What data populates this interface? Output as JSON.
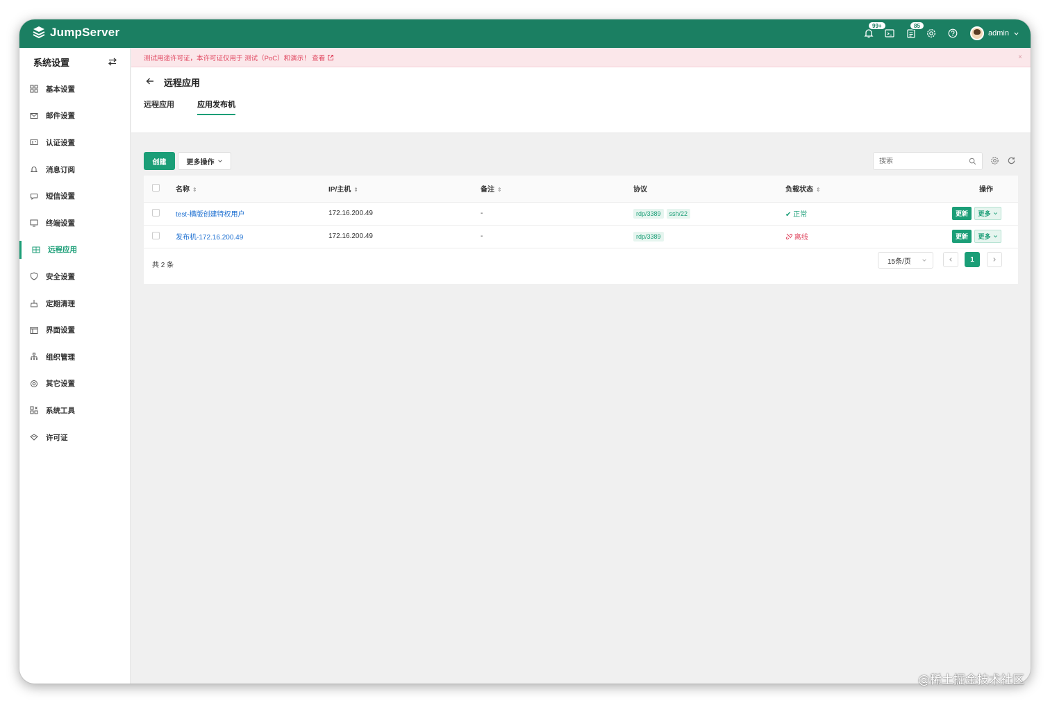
{
  "app": {
    "brand": "JumpServer",
    "accent": "#1b7f62",
    "primary": "#1b9e77"
  },
  "topbar": {
    "notifications_badge": "99+",
    "tickets_badge": "85",
    "user": "admin",
    "icons": [
      "bell-icon",
      "terminal-icon",
      "clipboard-icon",
      "gear-icon",
      "help-icon"
    ]
  },
  "sidebar": {
    "title": "系统设置",
    "items": [
      {
        "label": "基本设置",
        "icon": "grid-icon"
      },
      {
        "label": "邮件设置",
        "icon": "mail-icon"
      },
      {
        "label": "认证设置",
        "icon": "id-card-icon"
      },
      {
        "label": "消息订阅",
        "icon": "bell-icon"
      },
      {
        "label": "短信设置",
        "icon": "chat-icon"
      },
      {
        "label": "终端设置",
        "icon": "monitor-icon"
      },
      {
        "label": "远程应用",
        "icon": "app-icon",
        "active": true
      },
      {
        "label": "安全设置",
        "icon": "shield-icon"
      },
      {
        "label": "定期清理",
        "icon": "broom-icon"
      },
      {
        "label": "界面设置",
        "icon": "window-icon"
      },
      {
        "label": "组织管理",
        "icon": "org-icon"
      },
      {
        "label": "其它设置",
        "icon": "cog-icon"
      },
      {
        "label": "系统工具",
        "icon": "tools-icon"
      },
      {
        "label": "许可证",
        "icon": "license-icon"
      }
    ]
  },
  "alert": {
    "text": "测试用途许可证，本许可证仅用于 测试（PoC）和演示！ 查看",
    "close": "×"
  },
  "page": {
    "title": "远程应用",
    "tabs": [
      {
        "label": "远程应用"
      },
      {
        "label": "应用发布机",
        "active": true
      }
    ]
  },
  "toolbar": {
    "create": "创建",
    "more_actions": "更多操作",
    "search_placeholder": "搜索"
  },
  "table": {
    "headers": {
      "name": "名称",
      "ip": "IP/主机",
      "comment": "备注",
      "protocols": "协议",
      "status": "负载状态",
      "actions": "操作"
    },
    "rows": [
      {
        "name": "test-横版创建特权用户",
        "ip": "172.16.200.49",
        "comment": "-",
        "protocols": [
          "rdp/3389",
          "ssh/22"
        ],
        "status": "正常",
        "status_kind": "ok",
        "update": "更新",
        "more": "更多"
      },
      {
        "name": "发布机-172.16.200.49",
        "ip": "172.16.200.49",
        "comment": "-",
        "protocols": [
          "rdp/3389"
        ],
        "status": "离线",
        "status_kind": "offline",
        "update": "更新",
        "more": "更多"
      }
    ]
  },
  "pagination": {
    "total": "共 2 条",
    "page_size": "15条/页",
    "current_page": "1"
  },
  "watermark": "@稀土掘金技术社区"
}
